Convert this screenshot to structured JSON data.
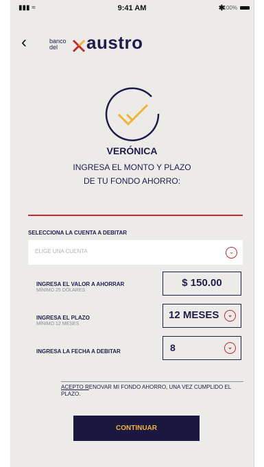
{
  "status_bar": {
    "signal": "▮▮▮ ≈",
    "time": "9:41 AM",
    "bluetooth": "✱",
    "battery": "100%"
  },
  "header": {
    "back_icon": "‹",
    "logo_small": "banco del",
    "logo_word": "austro"
  },
  "greeting": {
    "name": "VERÓNICA",
    "line1": "INGRESA EL MONTO Y PLAZO",
    "line2": "DE TU FONDO AHORRO:"
  },
  "account": {
    "section_label": "SELECCIONA LA CUENTA A DEBITAR",
    "placeholder": "ELIGE UNA CUENTA"
  },
  "amount": {
    "label": "INGRESA EL VALOR A AHORRAR",
    "sub": "MÍNIMO 25 DÓLARES",
    "value": "$ 150.00"
  },
  "term": {
    "label": "INGRESA EL PLAZO",
    "sub": "MÍNIMO 12 MESES",
    "value": "12 MESES"
  },
  "date": {
    "label": "INGRESA LA FECHA A DEBITAR",
    "value": "8"
  },
  "accept": {
    "bold": "ACEPTO R",
    "text": "ENOVAR MI FONDO AHORRO, UNA VEZ CUMPLIDO EL PLAZO."
  },
  "button": {
    "label": "CONTINUAR"
  },
  "colors": {
    "accent": "#c52b2b",
    "navy": "#1f1b4d",
    "button_text": "#f2b23a",
    "background": "#ecebe8"
  }
}
